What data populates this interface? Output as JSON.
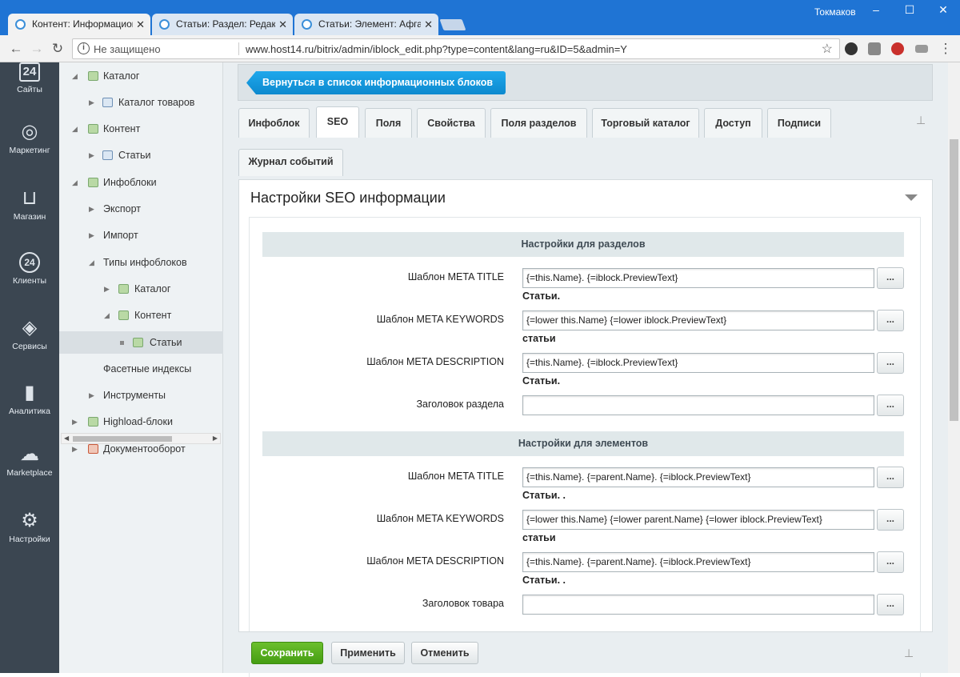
{
  "browser": {
    "tabs": [
      {
        "title": "Контент: Информацион"
      },
      {
        "title": "Статьи: Раздел: Редактир"
      },
      {
        "title": "Статьи: Элемент: Афганс"
      }
    ],
    "tab_close": "✕",
    "user": "Токмаков",
    "insecure": "Не защищено",
    "url": "www.host14.ru/bitrix/admin/iblock_edit.php?type=content&lang=ru&ID=5&admin=Y"
  },
  "leftbar": {
    "items": [
      {
        "label": "Сайты",
        "icon": "sites-icon",
        "glyph": "24"
      },
      {
        "label": "Маркетинг",
        "icon": "target-icon",
        "glyph": "◎"
      },
      {
        "label": "Магазин",
        "icon": "basket-icon",
        "glyph": "⊔"
      },
      {
        "label": "Клиенты",
        "icon": "clients-icon",
        "glyph": "24"
      },
      {
        "label": "Сервисы",
        "icon": "layers-icon",
        "glyph": "◈"
      },
      {
        "label": "Аналитика",
        "icon": "chart-icon",
        "glyph": "▮"
      },
      {
        "label": "Marketplace",
        "icon": "cloud-icon",
        "glyph": "☁"
      },
      {
        "label": "Настройки",
        "icon": "gear-icon",
        "glyph": "⚙"
      }
    ]
  },
  "tree": {
    "items": [
      {
        "label": "Каталог"
      },
      {
        "label": "Каталог товаров"
      },
      {
        "label": "Контент"
      },
      {
        "label": "Статьи"
      },
      {
        "label": "Инфоблоки"
      },
      {
        "label": "Экспорт"
      },
      {
        "label": "Импорт"
      },
      {
        "label": "Типы инфоблоков"
      },
      {
        "label": "Каталог"
      },
      {
        "label": "Контент"
      },
      {
        "label": "Статьи"
      },
      {
        "label": "Фасетные индексы"
      },
      {
        "label": "Инструменты"
      },
      {
        "label": "Highload-блоки"
      },
      {
        "label": "Документооборот"
      }
    ]
  },
  "main": {
    "back_button": "Вернуться в список информационных блоков",
    "tabs": [
      {
        "label": "Инфоблок"
      },
      {
        "label": "SEO"
      },
      {
        "label": "Поля"
      },
      {
        "label": "Свойства"
      },
      {
        "label": "Поля разделов"
      },
      {
        "label": "Торговый каталог"
      },
      {
        "label": "Доступ"
      },
      {
        "label": "Подписи"
      }
    ],
    "tab_row2": "Журнал событий",
    "active_tab": "SEO",
    "panel_title": "Настройки SEO информации",
    "sections": [
      {
        "title": "Настройки для разделов",
        "fields": [
          {
            "label": "Шаблон META TITLE",
            "value": "{=this.Name}. {=iblock.PreviewText}",
            "hint": "Статьи."
          },
          {
            "label": "Шаблон META KEYWORDS",
            "value": "{=lower this.Name} {=lower iblock.PreviewText}",
            "hint": "статьи"
          },
          {
            "label": "Шаблон META DESCRIPTION",
            "value": "{=this.Name}. {=iblock.PreviewText}",
            "hint": "Статьи."
          },
          {
            "label": "Заголовок раздела",
            "value": "",
            "hint": ""
          }
        ]
      },
      {
        "title": "Настройки для элементов",
        "fields": [
          {
            "label": "Шаблон META TITLE",
            "value": "{=this.Name}. {=parent.Name}. {=iblock.PreviewText}",
            "hint": "Статьи. ."
          },
          {
            "label": "Шаблон META KEYWORDS",
            "value": "{=lower this.Name} {=lower parent.Name} {=lower iblock.PreviewText}",
            "hint": "статьи"
          },
          {
            "label": "Шаблон META DESCRIPTION",
            "value": "{=this.Name}. {=parent.Name}. {=iblock.PreviewText}",
            "hint": "Статьи. ."
          },
          {
            "label": "Заголовок товара",
            "value": "",
            "hint": ""
          }
        ]
      }
    ],
    "field_button": "...",
    "buttons": {
      "save": "Сохранить",
      "apply": "Применить",
      "cancel": "Отменить"
    }
  },
  "colors": {
    "brand": "#1f74d4",
    "accent": "#1fa8ec",
    "save": "#459d12",
    "sidebar": "#3b4651"
  }
}
